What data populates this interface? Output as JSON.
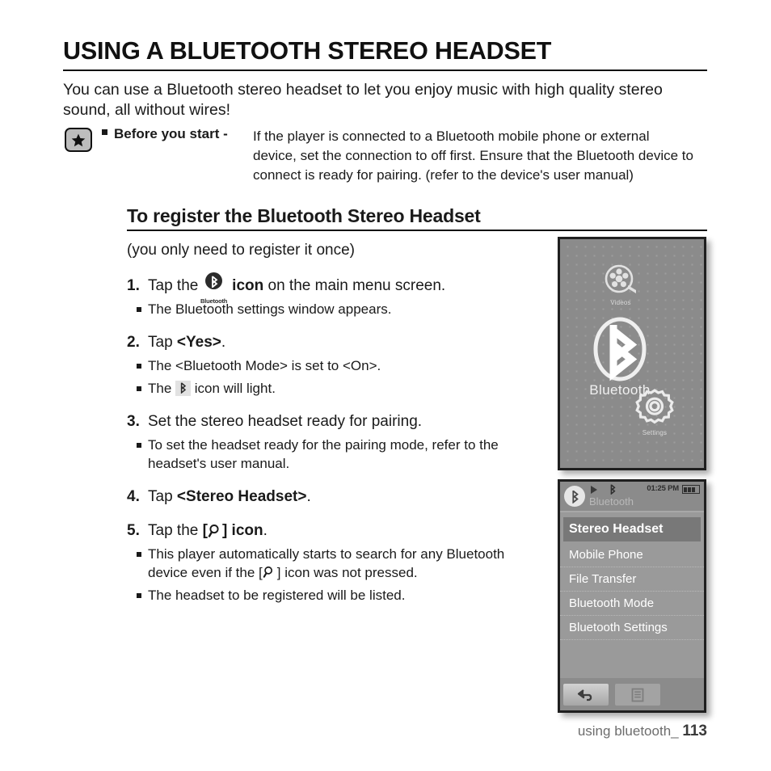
{
  "document": {
    "title": "USING A BLUETOOTH STEREO HEADSET",
    "intro": "You can use a Bluetooth stereo headset to let you enjoy music with high quality stereo sound, all without wires!",
    "subheading": "To register the Bluetooth Stereo Headset",
    "lead_note": "(you only need to register it once)"
  },
  "note": {
    "icon": "star-badge-icon",
    "label": "Before you start -",
    "text": "If the player is connected to a Bluetooth mobile phone or external device, set the connection to off first. Ensure that the Bluetooth device to connect is ready for pairing. (refer to the device's user manual)"
  },
  "steps": [
    {
      "num": "1.",
      "title_before": "Tap the",
      "icon": "bluetooth-icon",
      "icon_caption": "Bluetooth",
      "title_bold": "icon",
      "title_after": "on the main menu screen.",
      "subs": [
        "The Bluetooth settings window appears."
      ]
    },
    {
      "num": "2.",
      "title_before": "Tap",
      "title_bold": "<Yes>",
      "title_after": ".",
      "subs": [
        "The <Bluetooth Mode> is set to <On>."
      ],
      "sub_with_icon": {
        "before": "The",
        "icon": "bluetooth-small-icon",
        "after": "icon will light."
      }
    },
    {
      "num": "3.",
      "title_plain": "Set the stereo headset ready for pairing.",
      "subs": [
        "To set the headset ready for the pairing mode, refer to the headset's user manual."
      ]
    },
    {
      "num": "4.",
      "title_before": "Tap",
      "title_bold": "<Stereo Headset>",
      "title_after": "."
    },
    {
      "num": "5.",
      "title_before": "Tap the",
      "bracket_open": "[",
      "icon": "magnifier-icon",
      "bracket_close": "]",
      "title_bold": "icon",
      "title_after": ".",
      "sub_search_a": "This player automatically starts to search for any Bluetooth device even if the [",
      "sub_search_b": "] icon was not pressed.",
      "sub_last": "The headset to be registered will be listed."
    }
  ],
  "device_main_menu": {
    "items": [
      {
        "label": "Videos",
        "icon": "film-reel-icon"
      },
      {
        "label": "Bluetooth",
        "icon": "bluetooth-logo-icon"
      },
      {
        "label": "Settings",
        "icon": "gear-icon"
      }
    ]
  },
  "device_bluetooth_menu": {
    "status_bar": {
      "bluetooth_circle_icon": "bluetooth-circle-icon",
      "play_icon": "play-icon",
      "bluetooth_icon": "bluetooth-small-icon",
      "time": "01:25 PM",
      "battery_icon": "battery-full-icon"
    },
    "screen_title": "Bluetooth",
    "items": [
      "Stereo Headset",
      "Mobile Phone",
      "File Transfer",
      "Bluetooth Mode",
      "Bluetooth Settings"
    ],
    "selected_index": 0,
    "footer": {
      "back_icon": "back-arrow-icon",
      "list_icon": "list-menu-icon"
    }
  },
  "footer": {
    "chapter": "using bluetooth_",
    "page": "113"
  },
  "colors": {
    "ink": "#1a1a1a",
    "device_bg": "#8b8b8b",
    "menu_bg": "#9a9a9a",
    "selected_bg": "#787878",
    "footer_text": "#6d6d6d"
  }
}
